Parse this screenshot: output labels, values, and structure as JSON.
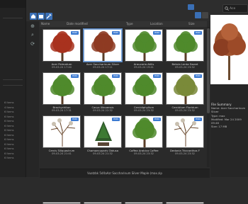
{
  "search": {
    "placeholder": "Ace"
  },
  "columns": [
    "Name",
    "Date modified",
    "Type",
    "Location",
    "Size"
  ],
  "tiles": [
    {
      "name": "Acer Palmatum",
      "date": "09-03-24 17:40",
      "badge": "max",
      "selected": false,
      "tree": "red"
    },
    {
      "name": "Acer Saccharinum Silver",
      "date": "09-03-24 17:11",
      "badge": "max",
      "selected": true,
      "tree": "brown"
    },
    {
      "name": "Araucaria Atilis",
      "date": "09-03-24 19:41",
      "badge": "max",
      "selected": false,
      "tree": "green"
    },
    {
      "name": "Betula Lenta Sweet",
      "date": "09-03-24 23:32",
      "badge": "max",
      "selected": false,
      "tree": "green"
    },
    {
      "name": "Brachychiton",
      "date": "09-03-24 17:31",
      "badge": "max",
      "selected": false,
      "tree": "green"
    },
    {
      "name": "Carya Illinoensis",
      "date": "09-03-24 22:32",
      "badge": "max",
      "selected": false,
      "tree": "green"
    },
    {
      "name": "Cercidiphyllum",
      "date": "09-03-24 23:32",
      "badge": "max",
      "selected": false,
      "tree": "green"
    },
    {
      "name": "Cercidium Floridum",
      "date": "09-03-24 23:32",
      "badge": "max",
      "selected": false,
      "tree": "olive"
    },
    {
      "name": "Cercis Siliquastrum",
      "date": "09-03-24 21:41",
      "badge": "max",
      "selected": false,
      "tree": "bare"
    },
    {
      "name": "Chamaecyparis Obtusa",
      "date": "09-03-24 21:32",
      "badge": "max",
      "selected": false,
      "tree": "bonsai"
    },
    {
      "name": "Coffea Arabica Coffee",
      "date": "09-03-24 23:32",
      "badge": "max",
      "selected": false,
      "tree": "green"
    },
    {
      "name": "Dedonia Triacanthos F",
      "date": "09-03-24 23:32",
      "badge": "max",
      "selected": false,
      "tree": "bare"
    }
  ],
  "sidebar_items": [
    "6 Items",
    "4 Items",
    "6 Items",
    "6 Items",
    "6 Items",
    "6 Items",
    "6 Items",
    "6 Items",
    "6 Items",
    "6 Items",
    "6 Items",
    "6 Items",
    "6 Items"
  ],
  "status": "Vuatzbk 5dXaAzr Saccharinum Silver Maple (max.zip",
  "summary": {
    "title": "File Summary",
    "lines": [
      "Name: Acer Saccharinum Silver",
      "Type: max",
      "Modified: Mar 24 2009 09:46",
      "Size: 17 MB"
    ]
  },
  "colors": {
    "accent": "#3a6fb5",
    "badge": "#3c7ad1",
    "background": "#2b2b2b"
  }
}
